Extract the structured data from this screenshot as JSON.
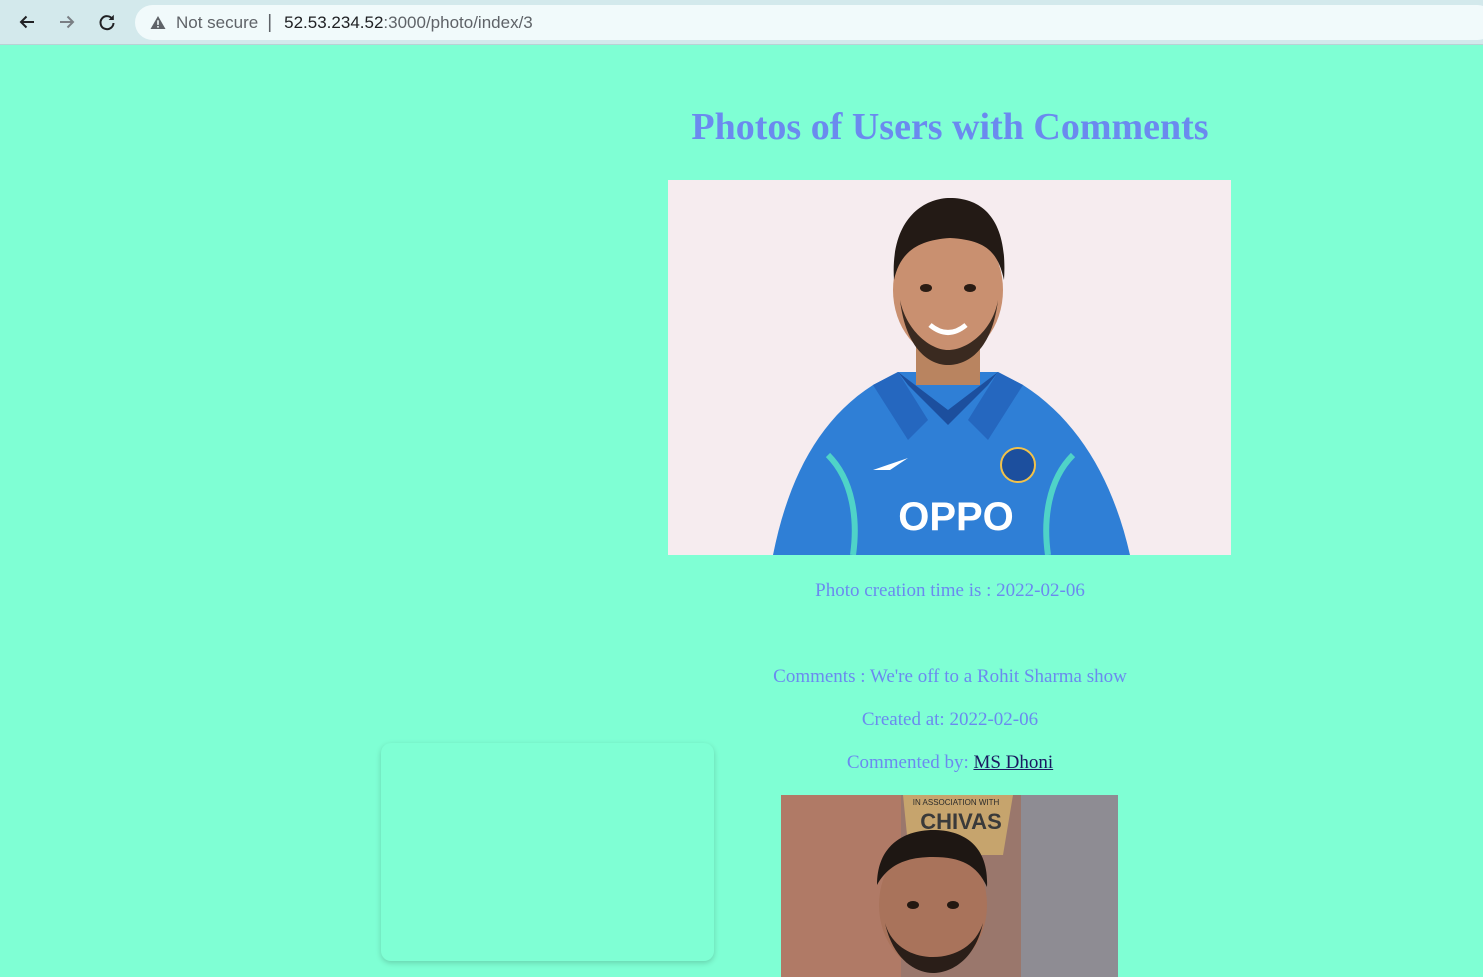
{
  "browser": {
    "security_label": "Not secure",
    "url_host": "52.53.234.52",
    "url_path": ":3000/photo/index/3"
  },
  "page": {
    "title": "Photos of Users with Comments",
    "photo_creation_label": "Photo creation time is : 2022-02-06",
    "comment_text": "Comments : We're off to a Rohit Sharma show",
    "created_at_label": "Created at: 2022-02-06",
    "commented_by_prefix": "Commented by:",
    "commenter_name": "MS Dhoni"
  },
  "photo_main": {
    "jersey_text": "OPPO"
  },
  "photo_second": {
    "banner_small": "IN ASSOCIATION WITH",
    "banner_brand": "CHIVAS"
  },
  "colors": {
    "background": "#7fffd4",
    "accent_text": "#6b8aef",
    "link": "#1a1a60"
  }
}
